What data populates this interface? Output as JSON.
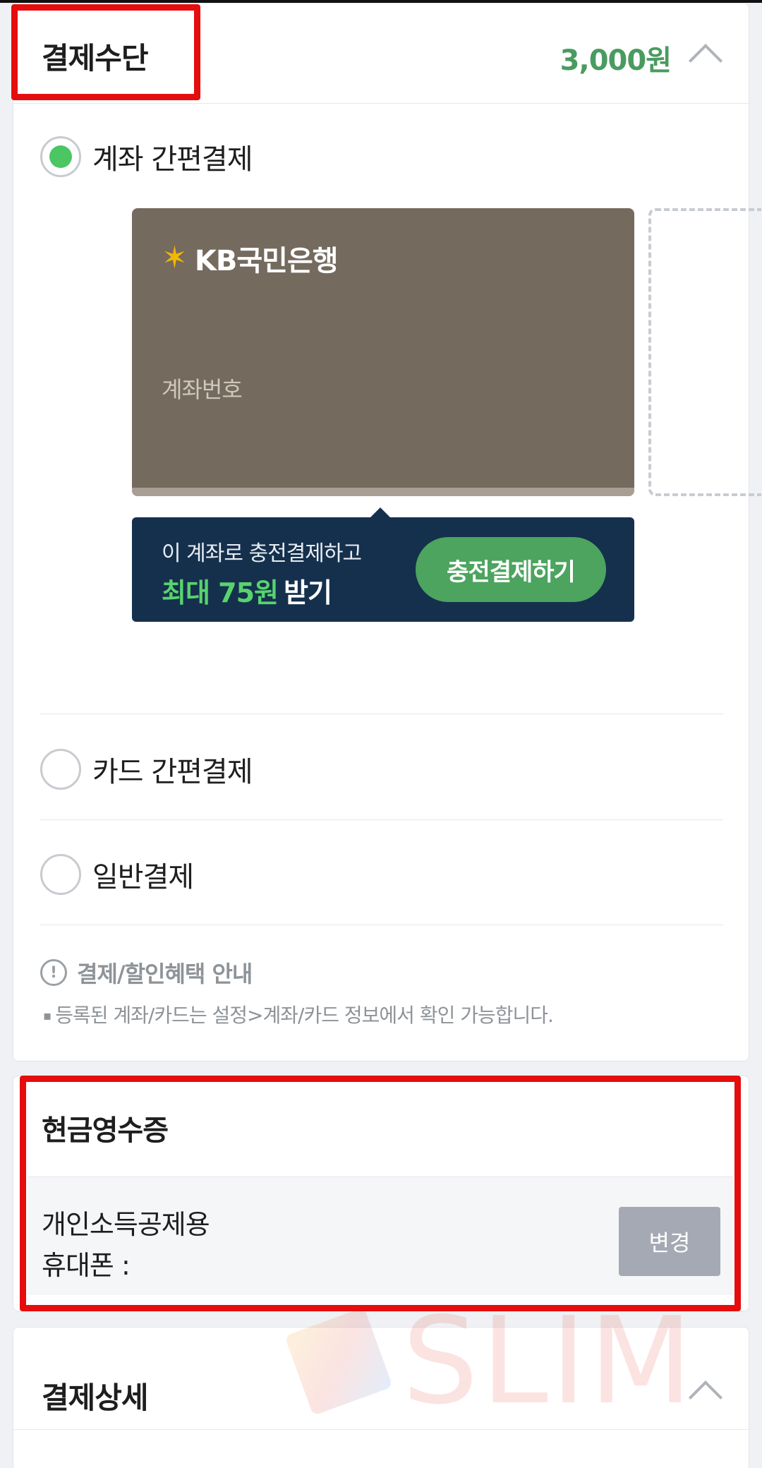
{
  "payment": {
    "title": "결제수단",
    "amount": "3,000원",
    "options": [
      {
        "label": "계좌 간편결제",
        "selected": true
      },
      {
        "label": "카드 간편결제",
        "selected": false
      },
      {
        "label": "일반결제",
        "selected": false
      }
    ],
    "card": {
      "bank_name": "KB국민은행",
      "account_label": "계좌번호"
    },
    "promo": {
      "line1": "이 계좌로 충전결제하고",
      "max_text": "최대 75원",
      "get_text": "받기",
      "button": "충전결제하기"
    },
    "info": {
      "title": "결제/할인혜택 안내",
      "note": "등록된 계좌/카드는 설정>계좌/카드 정보에서 확인 가능합니다."
    }
  },
  "receipt": {
    "title": "현금영수증",
    "type": "개인소득공제용",
    "phone_label": "휴대폰 :",
    "change_button": "변경"
  },
  "detail": {
    "title": "결제상세"
  },
  "watermark": {
    "text": "SLIM"
  },
  "colors": {
    "accent_green": "#4a9b60",
    "radio_on": "#4cc663",
    "promo_bg": "#15304d",
    "highlight_red": "#e50d0d",
    "card_bg": "#746a5e"
  },
  "icons": {
    "collapse": "chevron-up-icon",
    "info": "info-circle-icon",
    "bank_logo": "kb-star-icon"
  }
}
